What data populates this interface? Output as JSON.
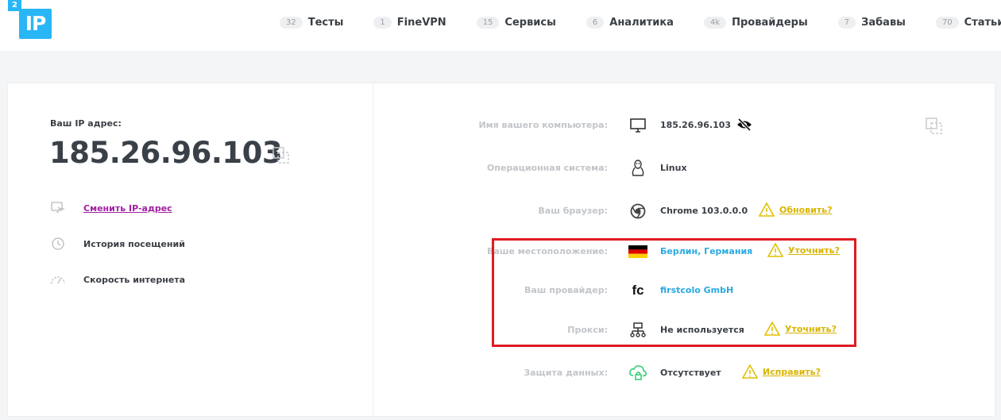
{
  "logo": {
    "badge": "2",
    "text": "IP"
  },
  "nav": [
    {
      "count": "32",
      "label": "Тесты"
    },
    {
      "count": "1",
      "label": "FineVPN"
    },
    {
      "count": "15",
      "label": "Сервисы"
    },
    {
      "count": "6",
      "label": "Аналитика"
    },
    {
      "count": "4k",
      "label": "Провайдеры"
    },
    {
      "count": "7",
      "label": "Забавы"
    },
    {
      "count": "70",
      "label": "Статьи"
    }
  ],
  "left": {
    "ip_label": "Ваш IP адрес:",
    "ip": "185.26.96.103",
    "links": [
      {
        "label": "Сменить IP-адрес",
        "icon": "change-ip-icon"
      },
      {
        "label": "История посещений",
        "icon": "history-icon"
      },
      {
        "label": "Скорость интернета",
        "icon": "speed-icon"
      }
    ]
  },
  "right": {
    "computer": {
      "label": "Имя вашего компьютера:",
      "value": "185.26.96.103",
      "icon": "monitor-icon"
    },
    "os": {
      "label": "Операционная система:",
      "value": "Linux",
      "icon": "linux-icon"
    },
    "browser": {
      "label": "Ваш браузер:",
      "value": "Chrome 103.0.0.0",
      "icon": "chrome-icon",
      "action": "Обновить?"
    },
    "location": {
      "label": "Ваше местоположение:",
      "value": "Берлин, Германия",
      "icon": "germany-flag-icon",
      "action": "Уточнить?"
    },
    "provider": {
      "label": "Ваш провайдер:",
      "value": "firstcolo GmbH",
      "icon_text": "fc"
    },
    "proxy": {
      "label": "Прокси:",
      "value": "Не используется",
      "icon": "network-icon",
      "action": "Уточнить?"
    },
    "protection": {
      "label": "Защита данных:",
      "value": "Отсутствует",
      "icon": "cloud-lock-icon",
      "action": "Исправить?"
    }
  },
  "colors": {
    "accent": "#29b6f6",
    "warning": "#d9b400",
    "link": "#a020a0",
    "highlight": "#e01b22"
  }
}
